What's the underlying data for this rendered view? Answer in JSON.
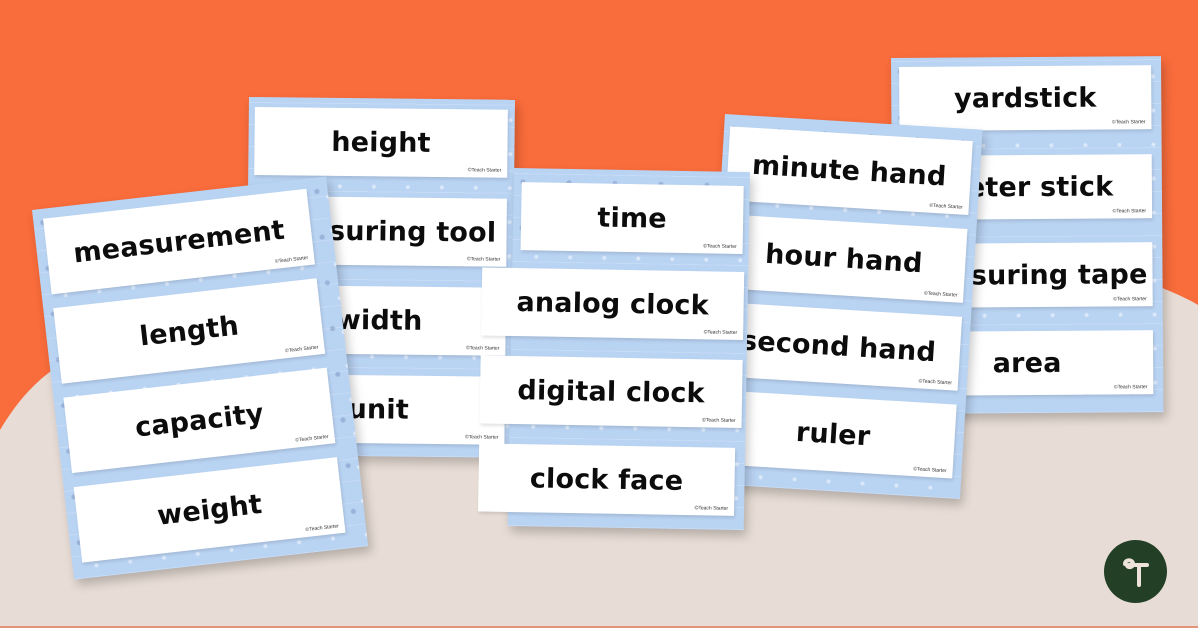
{
  "colors": {
    "background_orange": "#F96C3B",
    "background_beige": "#E8DDD6",
    "sheet_blue": "#B9D3F3",
    "card_white": "#FFFFFF",
    "text": "#0C0C0C",
    "logo_green": "#233F26"
  },
  "brand": {
    "card_mark": "©Teach Starter",
    "logo_icon": "teach-starter-t-logo"
  },
  "sheets": [
    {
      "name": "sheet-1",
      "cards": [
        "measurement",
        "length",
        "capacity",
        "weight"
      ]
    },
    {
      "name": "sheet-2",
      "cards": [
        "height",
        "measuring tool",
        "width",
        "unit"
      ]
    },
    {
      "name": "sheet-3",
      "cards": [
        "time",
        "analog clock",
        "digital clock",
        "clock face"
      ]
    },
    {
      "name": "sheet-4",
      "cards": [
        "minute hand",
        "hour hand",
        "second hand",
        "ruler"
      ]
    },
    {
      "name": "sheet-5",
      "cards": [
        "yardstick",
        "meter stick",
        "measuring tape",
        "area"
      ]
    }
  ]
}
